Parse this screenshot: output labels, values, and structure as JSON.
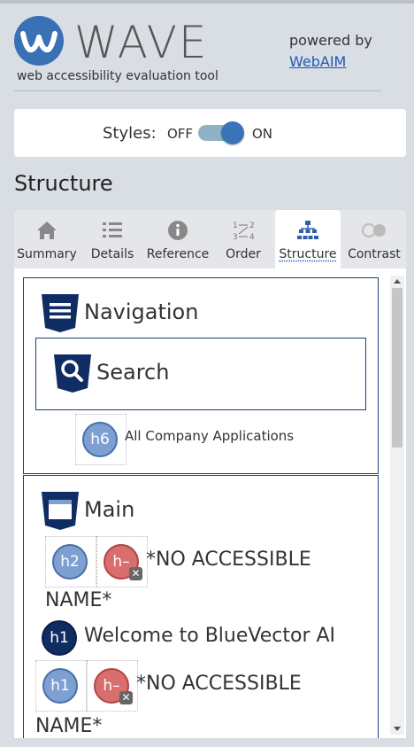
{
  "header": {
    "logo_text": "WAVE",
    "tagline": "web accessibility evaluation tool",
    "powered_by": "powered by",
    "webaim_link": "WebAIM"
  },
  "styles_toggle": {
    "label": "Styles:",
    "off": "OFF",
    "on": "ON",
    "state": "on"
  },
  "section_title": "Structure",
  "tabs": [
    {
      "label": "Summary",
      "icon": "home-icon",
      "active": false
    },
    {
      "label": "Details",
      "icon": "list-icon",
      "active": false
    },
    {
      "label": "Reference",
      "icon": "info-icon",
      "active": false
    },
    {
      "label": "Order",
      "icon": "order-icon",
      "active": false
    },
    {
      "label": "Structure",
      "icon": "structure-icon",
      "active": true
    },
    {
      "label": "Contrast",
      "icon": "contrast-icon",
      "active": false
    }
  ],
  "structure": {
    "navigation": {
      "title": "Navigation",
      "search": {
        "title": "Search"
      },
      "h6": {
        "badge": "h6",
        "text": "All Company Applications"
      }
    },
    "main": {
      "title": "Main",
      "row1": {
        "badge1": "h2",
        "badge2": "h–",
        "text1": "*NO ACCESSIBLE",
        "text2": "NAME*"
      },
      "h1_heading": {
        "badge": "h1",
        "text": "Welcome to BlueVector AI"
      },
      "row2": {
        "badge1": "h1",
        "badge2": "h–",
        "text1": "*NO ACCESSIBLE",
        "text2": "NAME*"
      }
    }
  },
  "colors": {
    "accent": "#3b73b9",
    "region_border": "#1a3f7a",
    "link": "#1c5bb5",
    "badge_blue": "#7d9fd1",
    "badge_error": "#d96e6e",
    "badge_navy": "#0f2c63"
  }
}
